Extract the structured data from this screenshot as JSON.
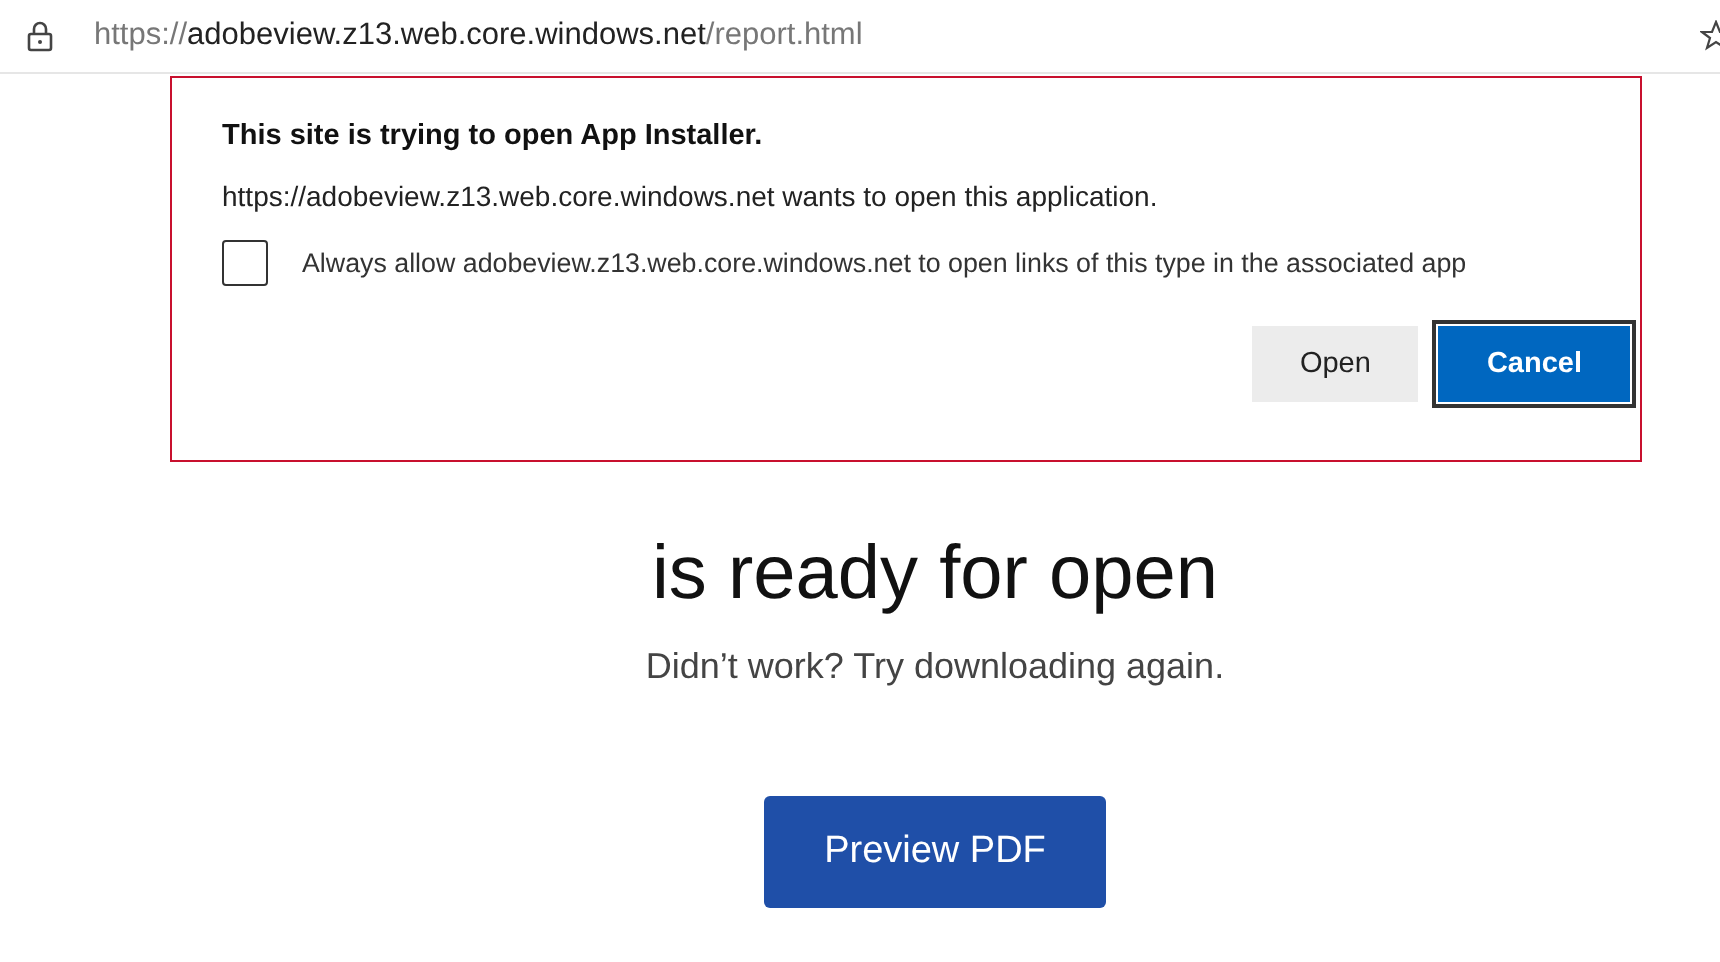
{
  "address_bar": {
    "scheme": "https://",
    "host": "adobeview.z13.web.core.windows.net",
    "path": "/report.html"
  },
  "page": {
    "heading": "is ready for open",
    "subtext": "Didn’t work? Try downloading again.",
    "button": "Preview PDF"
  },
  "dialog": {
    "title": "This site is trying to open App Installer.",
    "message": "https://adobeview.z13.web.core.windows.net wants to open this application.",
    "checkbox": {
      "label": "Always allow adobeview.z13.web.core.windows.net to open links of this type in the associated app",
      "checked": false
    },
    "buttons": [
      {
        "label": "Open",
        "kind": "secondary"
      },
      {
        "label": "Cancel",
        "kind": "primary"
      }
    ]
  }
}
